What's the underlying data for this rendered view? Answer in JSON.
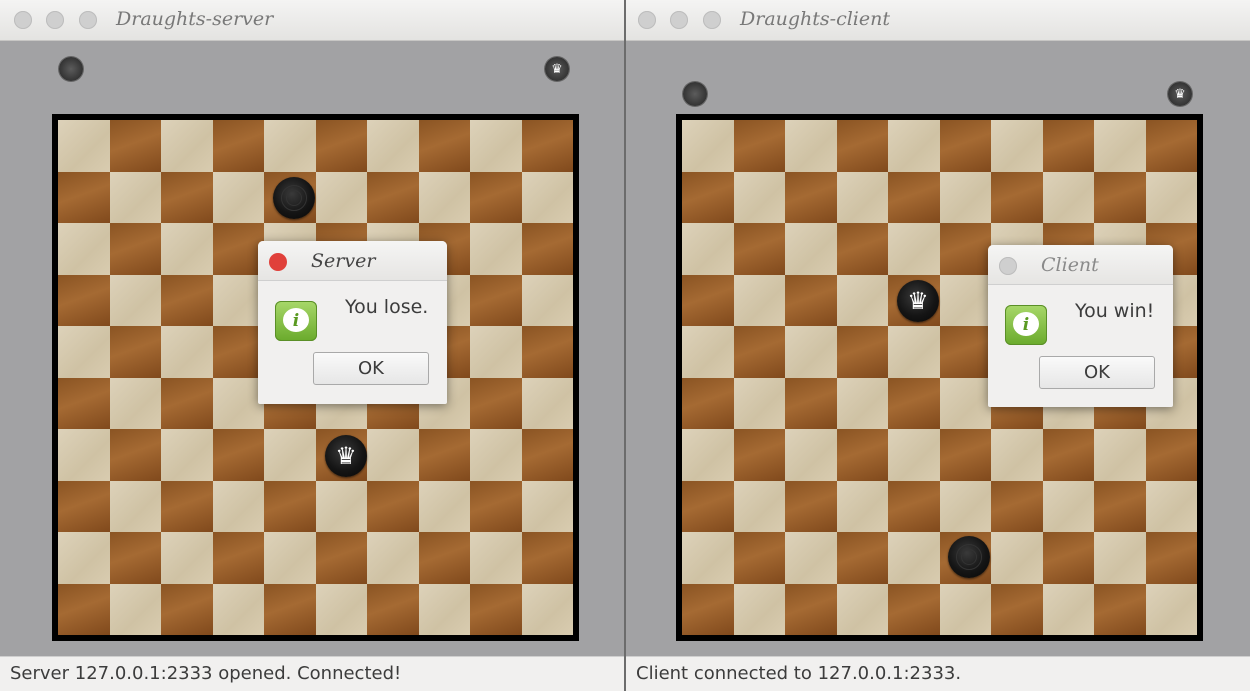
{
  "server_window": {
    "title": "Draughts-server",
    "status": "Server 127.0.0.1:2333 opened. Connected!",
    "dialog": {
      "title": "Server",
      "message": "You lose.",
      "ok_label": "OK"
    }
  },
  "client_window": {
    "title": "Draughts-client",
    "status": "Client connected to 127.0.0.1:2333.",
    "dialog": {
      "title": "Client",
      "message": "You win!",
      "ok_label": "OK"
    }
  },
  "colors": {
    "board_frame": "#000000",
    "light_square": "#d6c9ac",
    "dark_square": "#96602b",
    "dialog_close_active": "#e0403a",
    "info_icon": "#7dbb3a"
  }
}
